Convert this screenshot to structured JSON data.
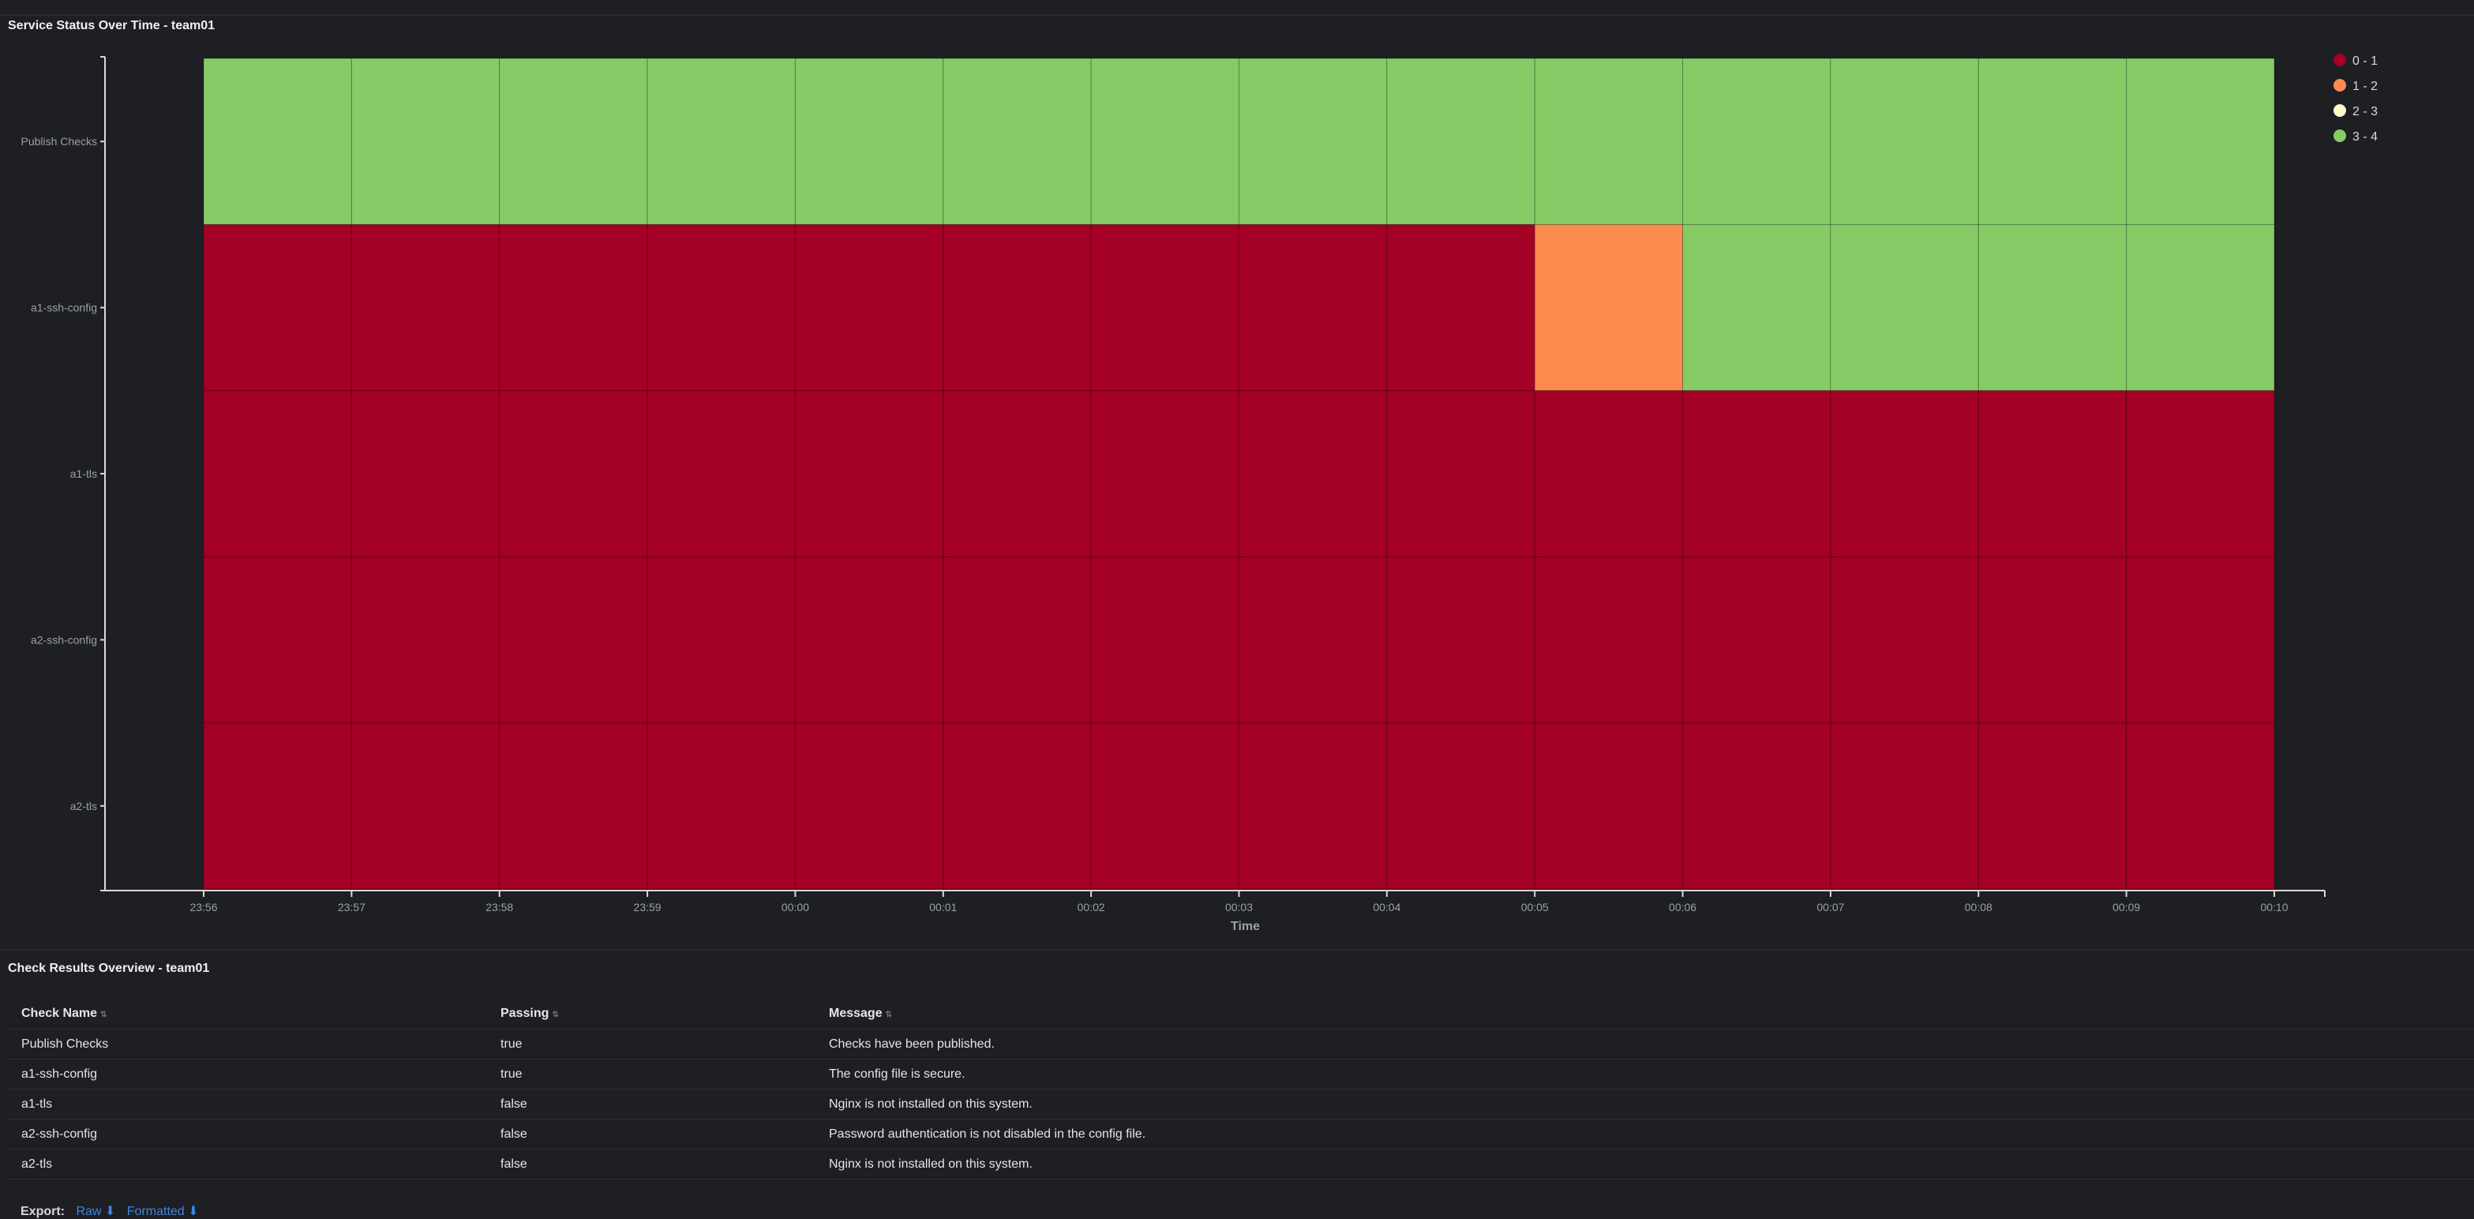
{
  "heatmap_panel": {
    "title": "Service Status Over Time - team01"
  },
  "chart_data": {
    "type": "heatmap",
    "title": "",
    "xlabel": "Time",
    "ylabel": "",
    "x": [
      "23:56",
      "23:57",
      "23:58",
      "23:59",
      "00:00",
      "00:01",
      "00:02",
      "00:03",
      "00:04",
      "00:05",
      "00:06",
      "00:07",
      "00:08",
      "00:09",
      "00:10"
    ],
    "y": [
      "Publish Checks",
      "a1-ssh-config",
      "a1-tls",
      "a2-ssh-config",
      "a2-tls"
    ],
    "values": [
      [
        4,
        4,
        4,
        4,
        4,
        4,
        4,
        4,
        4,
        4,
        4,
        4,
        4,
        4
      ],
      [
        1,
        1,
        1,
        1,
        1,
        1,
        1,
        1,
        1,
        2,
        4,
        4,
        4,
        4
      ],
      [
        1,
        1,
        1,
        1,
        1,
        1,
        1,
        1,
        1,
        1,
        1,
        1,
        1,
        1
      ],
      [
        1,
        1,
        1,
        1,
        1,
        1,
        1,
        1,
        1,
        1,
        1,
        1,
        1,
        1
      ],
      [
        1,
        1,
        1,
        1,
        1,
        1,
        1,
        1,
        1,
        1,
        1,
        1,
        1,
        1
      ]
    ],
    "legend": [
      {
        "label": "0 - 1",
        "color": "#a50026"
      },
      {
        "label": "1 - 2",
        "color": "#fb8b4e"
      },
      {
        "label": "2 - 3",
        "color": "#fef8c6"
      },
      {
        "label": "3 - 4",
        "color": "#86cb66"
      }
    ],
    "legend_position": "top-right"
  },
  "table_panel": {
    "title": "Check Results Overview - team01",
    "headers": [
      "Check Name",
      "Passing",
      "Message"
    ],
    "rows": [
      {
        "name": "Publish Checks",
        "passing": "true",
        "message": "Checks have been published."
      },
      {
        "name": "a1-ssh-config",
        "passing": "true",
        "message": "The config file is secure."
      },
      {
        "name": "a1-tls",
        "passing": "false",
        "message": "Nginx is not installed on this system."
      },
      {
        "name": "a2-ssh-config",
        "passing": "false",
        "message": "Password authentication is not disabled in the config file."
      },
      {
        "name": "a2-tls",
        "passing": "false",
        "message": "Nginx is not installed on this system."
      }
    ]
  },
  "export": {
    "label": "Export:",
    "raw": "Raw",
    "formatted": "Formatted"
  },
  "icons": {
    "sort": "sort-icon",
    "download": "download-icon"
  }
}
